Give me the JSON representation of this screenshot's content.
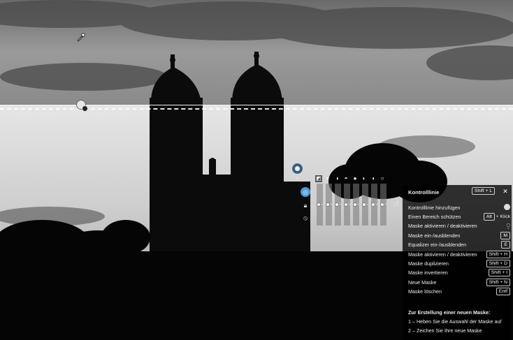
{
  "theme": {
    "accent": "#4a9ad6",
    "panel_bg": "#000000",
    "text": "#eeeeee"
  },
  "canvas_icons": {
    "picker": "eyedropper-icon",
    "control_line_handle": "control-line-handle-icon",
    "mask_pin": "mask-pin-icon",
    "tools": [
      "control-line-tool-icon",
      "protect-area-icon",
      "mask-toggle-icon"
    ],
    "equalizer_icons": [
      "exposure-icon",
      "contrast-icon",
      "brightness-icon",
      "shadows-icon",
      "whites-icon",
      "blacks-icon",
      "saturation-icon",
      "structure-icon"
    ],
    "reset": "reset-icon"
  },
  "help_panel": {
    "title": "Kontrolllinie",
    "title_shortcut": "Shift + L",
    "close_icon": "close-icon",
    "rows": [
      {
        "label": "Kontrolllinie hinzufügen",
        "shortcut": "",
        "icon": "mask-pin-icon"
      },
      {
        "label": "Einen Bereich schützen",
        "shortcut": "Alt",
        "suffix": "+ Klick"
      },
      {
        "label": "Maske aktivieren / deaktivieren",
        "shortcut": "",
        "icon": "mask-toggle-icon"
      },
      {
        "label": "Maske ein-/ausblenden",
        "shortcut": "M"
      },
      {
        "label": "Equalizer ein-/ausblenden",
        "shortcut": "E"
      },
      {
        "label": "Maske aktivieren / deaktivieren",
        "shortcut": "Shift + H"
      },
      {
        "label": "Maske duplizieren",
        "shortcut": "Shift + D"
      },
      {
        "label": "Maske invertieren",
        "shortcut": "Shift + I"
      },
      {
        "label": "Neue Maske",
        "shortcut": "Shift + N"
      },
      {
        "label": "Maske löschen",
        "shortcut": "Entf"
      }
    ],
    "help_title": "Zur Erstellung einer neuen Maske:",
    "help_steps": [
      "1 – Heben Sie die Auswahl der Maske auf",
      "2 – Zeichen Sie Ihre neue Maske"
    ]
  }
}
